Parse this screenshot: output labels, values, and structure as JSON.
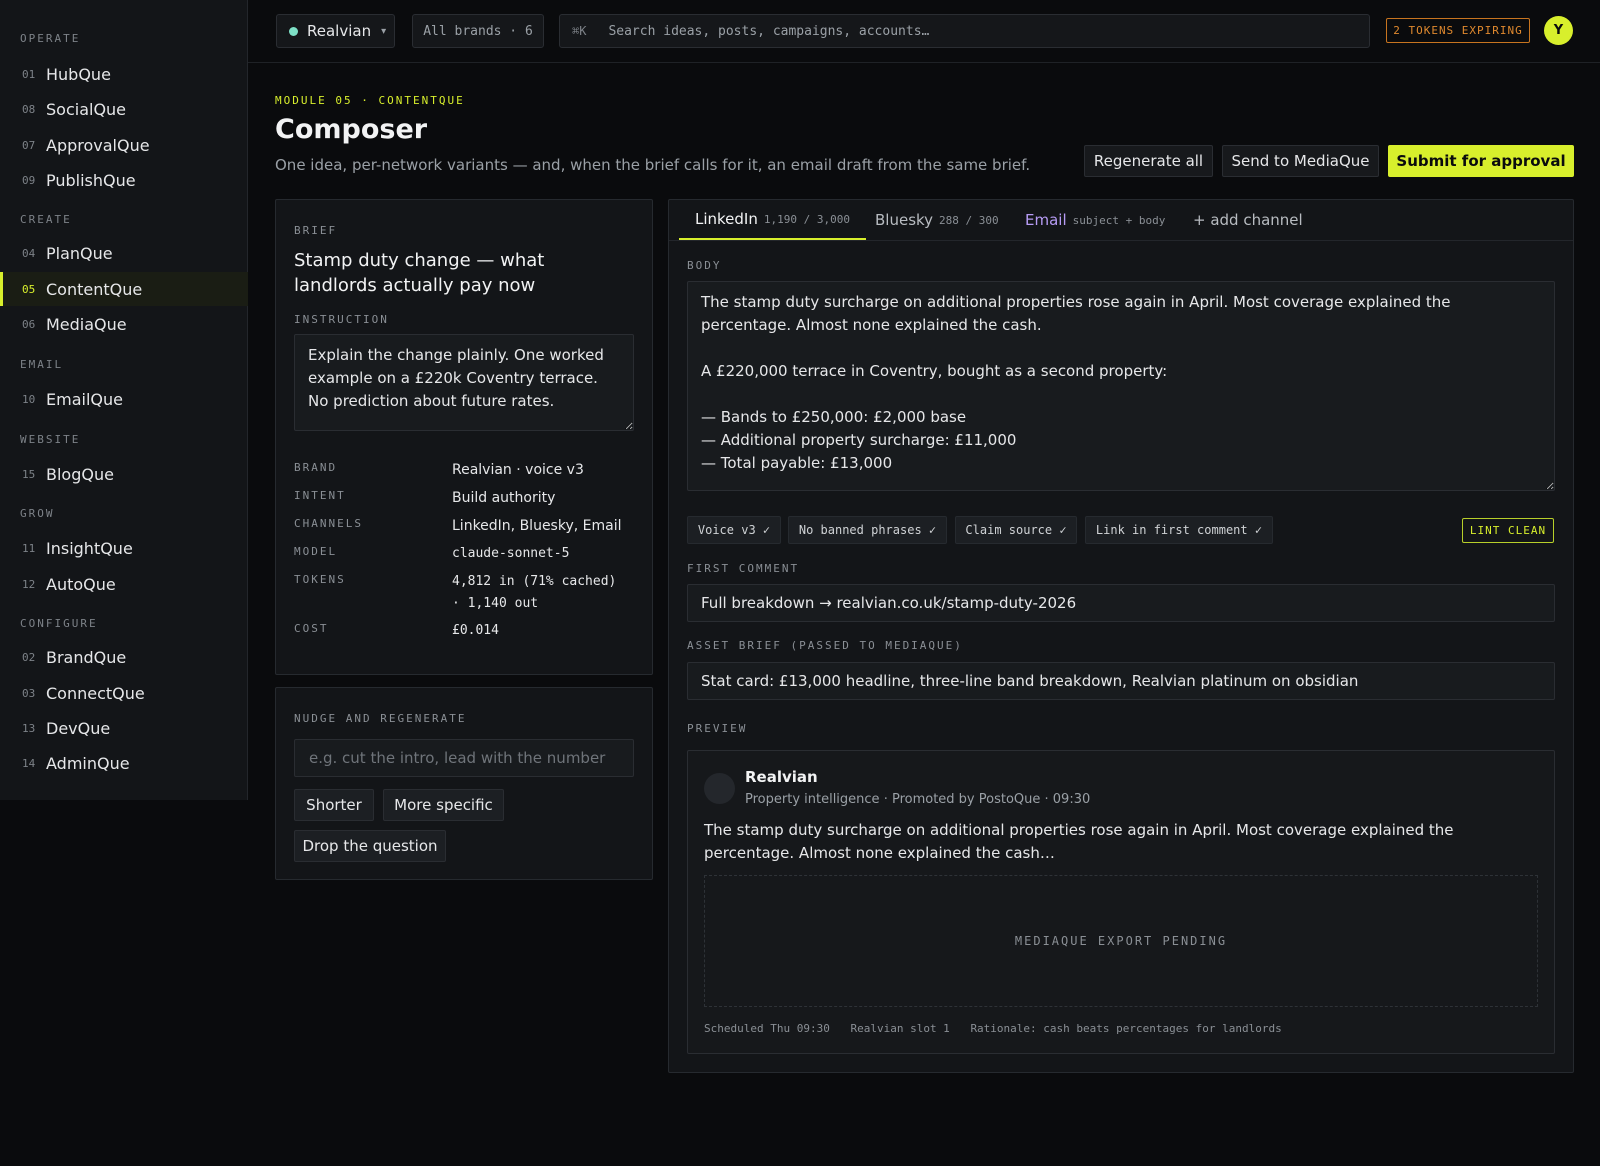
{
  "sidebar": {
    "sections": [
      {
        "label": "OPERATE",
        "items": [
          {
            "num": "01",
            "label": "HubQue"
          },
          {
            "num": "08",
            "label": "SocialQue"
          },
          {
            "num": "07",
            "label": "ApprovalQue"
          },
          {
            "num": "09",
            "label": "PublishQue"
          }
        ]
      },
      {
        "label": "CREATE",
        "items": [
          {
            "num": "04",
            "label": "PlanQue"
          },
          {
            "num": "05",
            "label": "ContentQue"
          },
          {
            "num": "06",
            "label": "MediaQue"
          }
        ]
      },
      {
        "label": "EMAIL",
        "items": [
          {
            "num": "10",
            "label": "EmailQue"
          }
        ]
      },
      {
        "label": "WEBSITE",
        "items": [
          {
            "num": "15",
            "label": "BlogQue"
          }
        ]
      },
      {
        "label": "GROW",
        "items": [
          {
            "num": "11",
            "label": "InsightQue"
          },
          {
            "num": "12",
            "label": "AutoQue"
          }
        ]
      },
      {
        "label": "CONFIGURE",
        "items": [
          {
            "num": "02",
            "label": "BrandQue"
          },
          {
            "num": "03",
            "label": "ConnectQue"
          },
          {
            "num": "13",
            "label": "DevQue"
          },
          {
            "num": "14",
            "label": "AdminQue"
          }
        ]
      }
    ],
    "active": "ContentQue"
  },
  "topbar": {
    "brand": "Realvian",
    "caret": "▾",
    "brands_pill": "All brands · 6",
    "search_kbd": "⌘K",
    "search_placeholder": "Search ideas, posts, campaigns, accounts…",
    "tokens_badge": "2 TOKENS EXPIRING",
    "avatar_initial": "Y"
  },
  "header": {
    "module": "MODULE 05 · CONTENTQUE",
    "title": "Composer",
    "subtitle": "One idea, per-network variants — and, when the brief calls for it, an email draft from the same brief.",
    "regenerate_all": "Regenerate all",
    "send_to_mediaque": "Send to MediaQue",
    "submit": "Submit for approval"
  },
  "brief": {
    "caption": "BRIEF",
    "title": "Stamp duty change — what landlords actually pay now",
    "instruction_caption": "INSTRUCTION",
    "instruction": "Explain the change plainly. One worked example on a £220k Coventry terrace. No prediction about future rates.",
    "meta": {
      "brand_key": "BRAND",
      "brand": "Realvian · voice v3",
      "intent_key": "INTENT",
      "intent": "Build authority",
      "channels_key": "CHANNELS",
      "channels": "LinkedIn, Bluesky, Email",
      "model_key": "MODEL",
      "model": "claude-sonnet-5",
      "tokens_key": "TOKENS",
      "tokens_line1": "4,812 in (71% cached)",
      "tokens_line2": "· 1,140 out",
      "cost_key": "COST",
      "cost": "£0.014"
    }
  },
  "nudge": {
    "caption": "NUDGE AND REGENERATE",
    "placeholder": "e.g. cut the intro, lead with the number",
    "shorter": "Shorter",
    "more_specific": "More specific",
    "drop_question": "Drop the question"
  },
  "tabs": {
    "linkedin": "LinkedIn",
    "linkedin_count": "1,190 / 3,000",
    "bluesky": "Bluesky",
    "bluesky_count": "288 / 300",
    "email": "Email",
    "email_count": "subject + body",
    "add": "+ add channel"
  },
  "editor": {
    "body_caption": "BODY",
    "body": "The stamp duty surcharge on additional properties rose again in April. Most coverage explained the percentage. Almost none explained the cash.\n\nA £220,000 terrace in Coventry, bought as a second property:\n\n— Bands to £250,000: £2,000 base\n— Additional property surcharge: £11,000\n— Total payable: £13,000",
    "lints": [
      "Voice v3 ✓",
      "No banned phrases ✓",
      "Claim source ✓",
      "Link in first comment ✓"
    ],
    "lint_clean": "LINT CLEAN",
    "first_comment_caption": "FIRST COMMENT",
    "first_comment": "Full breakdown → realvian.co.uk/stamp-duty-2026",
    "asset_caption": "ASSET BRIEF (PASSED TO MEDIAQUE)",
    "asset_brief": "Stat card: £13,000 headline, three-line band breakdown, Realvian platinum on obsidian"
  },
  "preview": {
    "caption": "PREVIEW",
    "name": "Realvian",
    "meta": "Property intelligence · Promoted by PostoQue · 09:30",
    "text": "The stamp duty surcharge on additional properties rose again in April. Most coverage explained the percentage. Almost none explained the cash…",
    "media_placeholder": "MEDIAQUE EXPORT PENDING",
    "foot_scheduled": "Scheduled Thu 09:30",
    "foot_slot": "Realvian slot 1",
    "foot_rationale": "Rationale: cash beats percentages for landlords"
  },
  "colors": {
    "accent": "#d8ef2c",
    "warning": "#e0892e",
    "email": "#b79cf5",
    "status_dot": "#7ee0c6"
  }
}
